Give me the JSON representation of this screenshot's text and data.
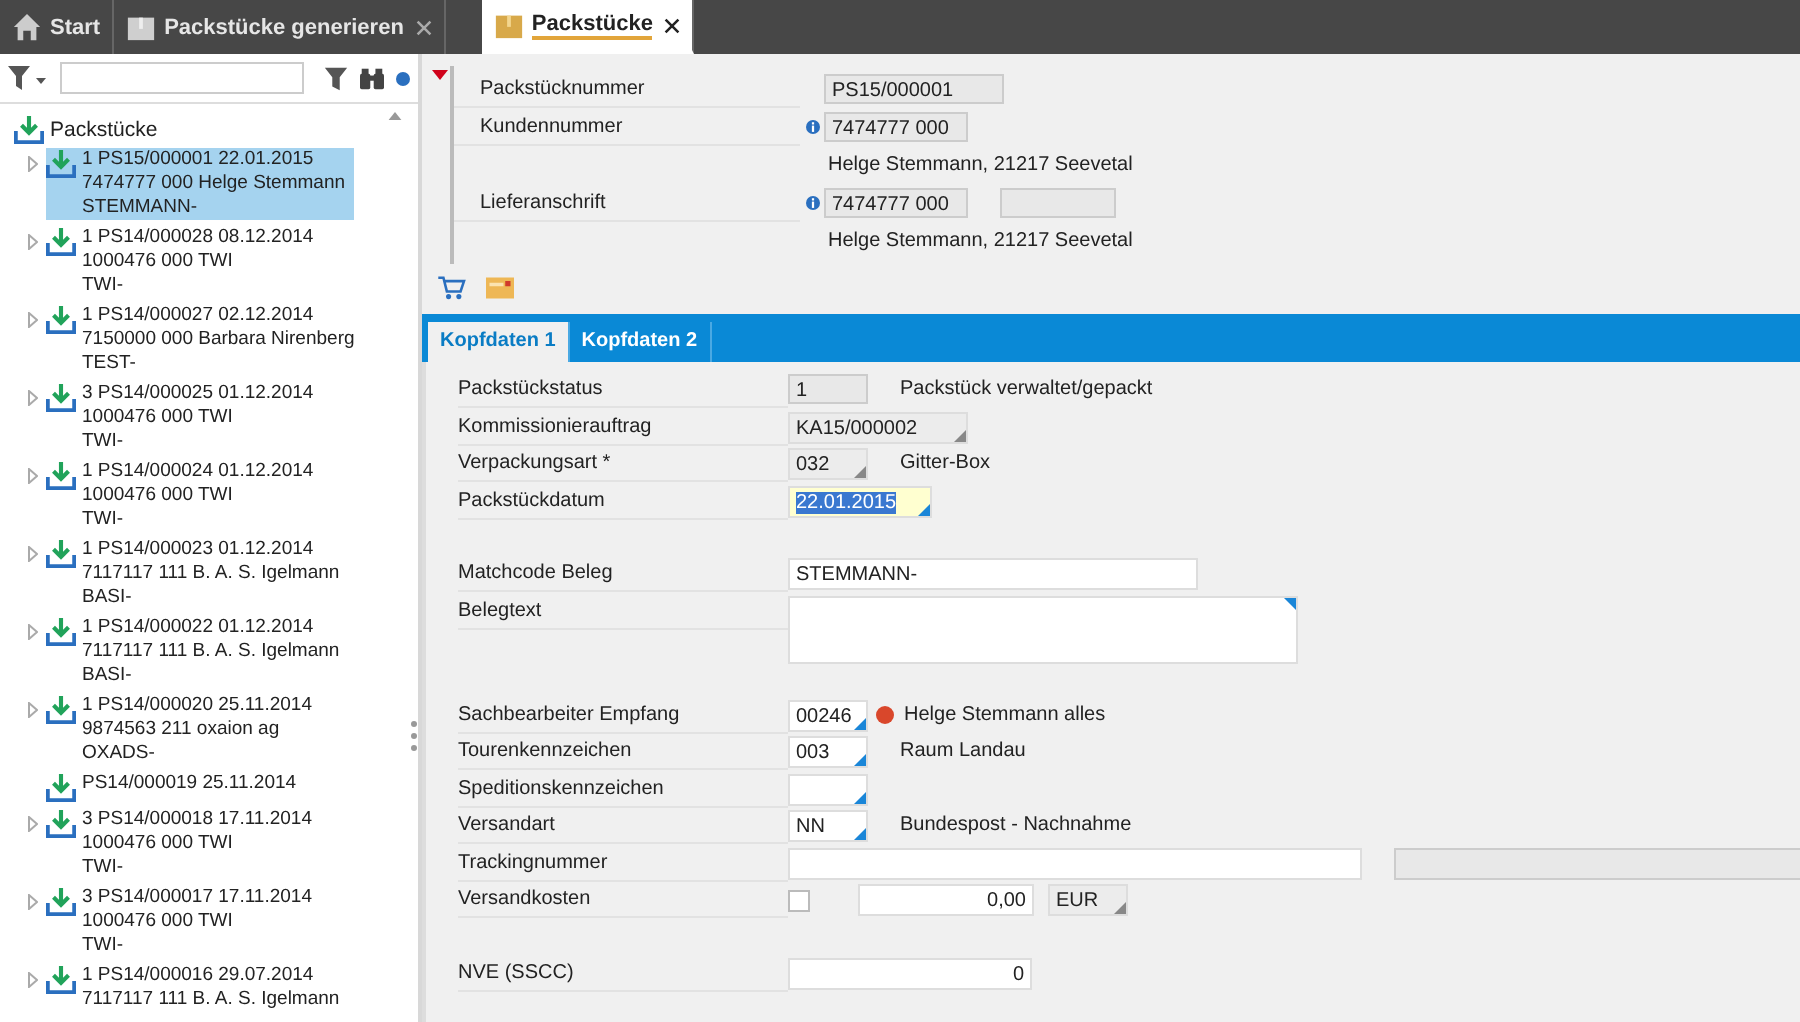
{
  "tabs": [
    {
      "label": "Start",
      "closable": false,
      "selected": false
    },
    {
      "label": "Packstücke generieren",
      "closable": true,
      "selected": false
    },
    {
      "label": "Packstücke",
      "closable": true,
      "selected": true
    }
  ],
  "tree": {
    "root": "Packstücke",
    "items": [
      {
        "lines": [
          "1 PS15/000001 22.01.2015",
          "7474777 000 Helge Stemmann",
          "STEMMANN-"
        ],
        "expandable": true,
        "selected": true
      },
      {
        "lines": [
          "1 PS14/000028 08.12.2014",
          "1000476 000 TWI",
          "TWI-"
        ],
        "expandable": true,
        "selected": false
      },
      {
        "lines": [
          "1 PS14/000027 02.12.2014",
          "7150000 000 Barbara Nirenberg",
          "TEST-"
        ],
        "expandable": true,
        "selected": false
      },
      {
        "lines": [
          "3 PS14/000025 01.12.2014",
          "1000476 000 TWI",
          "TWI-"
        ],
        "expandable": true,
        "selected": false
      },
      {
        "lines": [
          "1 PS14/000024 01.12.2014",
          "1000476 000 TWI",
          "TWI-"
        ],
        "expandable": true,
        "selected": false
      },
      {
        "lines": [
          "1 PS14/000023 01.12.2014",
          "7117117 111 B. A. S. Igelmann",
          "BASI-"
        ],
        "expandable": true,
        "selected": false
      },
      {
        "lines": [
          "1 PS14/000022 01.12.2014",
          "7117117 111 B. A. S. Igelmann",
          "BASI-"
        ],
        "expandable": true,
        "selected": false
      },
      {
        "lines": [
          "1 PS14/000020 25.11.2014",
          "9874563 211 oxaion ag",
          "OXADS-"
        ],
        "expandable": true,
        "selected": false
      },
      {
        "lines": [
          "PS14/000019 25.11.2014"
        ],
        "expandable": false,
        "selected": false
      },
      {
        "lines": [
          "3 PS14/000018 17.11.2014",
          "1000476 000 TWI",
          "TWI-"
        ],
        "expandable": true,
        "selected": false
      },
      {
        "lines": [
          "3 PS14/000017 17.11.2014",
          "1000476 000 TWI",
          "TWI-"
        ],
        "expandable": true,
        "selected": false
      },
      {
        "lines": [
          "1 PS14/000016 29.07.2014",
          "7117117 111 B. A. S. Igelmann"
        ],
        "expandable": true,
        "selected": false
      }
    ]
  },
  "header": [
    {
      "label": "Packstücknummer",
      "value": "PS15/000001",
      "info": false,
      "kind": "plain"
    },
    {
      "label": "Kundennummer",
      "value": "7474777 000",
      "info": true,
      "kind": "plain",
      "note": "Helge Stemmann, 21217 Seevetal"
    },
    {
      "label": "Lieferanschrift",
      "value": "7474777 000",
      "info": true,
      "kind": "with_extra",
      "note": "Helge Stemmann, 21217 Seevetal"
    }
  ],
  "subtabs": [
    {
      "label": "Kopfdaten 1",
      "selected": true
    },
    {
      "label": "Kopfdaten 2",
      "selected": false
    }
  ],
  "groups": [
    {
      "rows": [
        {
          "label": "Packstückstatus",
          "kind": "status",
          "value": "1",
          "desc": "Packstück verwaltet/gepackt"
        },
        {
          "label": "Kommissionierauftrag",
          "kind": "dropdown",
          "value": "KA15/000002"
        },
        {
          "label": "Verpackungsart *",
          "kind": "code_dropdown",
          "value": "032",
          "desc": "Gitter-Box"
        },
        {
          "label": "Packstückdatum",
          "kind": "date",
          "value": "22.01.2015",
          "selected": true
        }
      ]
    },
    {
      "rows": [
        {
          "label": "Matchcode Beleg",
          "kind": "text",
          "value": "STEMMANN-"
        },
        {
          "label": "Belegtext",
          "kind": "textarea"
        }
      ]
    },
    {
      "rows": [
        {
          "label": "Sachbearbeiter Empfang",
          "kind": "lookup",
          "value": "00246",
          "color": "#d9472b",
          "desc": "Helge Stemmann alles"
        },
        {
          "label": "Tourenkennzeichen",
          "kind": "lookup",
          "value": "003",
          "desc": "Raum Landau"
        },
        {
          "label": "Speditionskennzeichen",
          "kind": "lookup"
        },
        {
          "label": "Versandart",
          "kind": "lookup",
          "value": "NN",
          "desc": "Bundespost - Nachnahme"
        },
        {
          "label": "Trackingnummer",
          "kind": "tracking"
        },
        {
          "label": "Versandkosten",
          "kind": "amount",
          "checked": false,
          "value": "0,00",
          "currency": "EUR"
        }
      ]
    },
    {
      "rows": [
        {
          "label": "NVE (SSCC)",
          "kind": "number",
          "value": "0"
        }
      ]
    }
  ]
}
